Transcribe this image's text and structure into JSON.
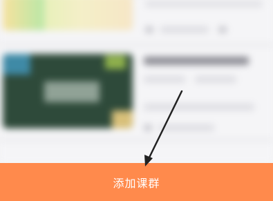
{
  "bottom_bar": {
    "label": "添加课群",
    "color": "#ff8a4c"
  },
  "course_list": {
    "items": [
      {
        "thumbnail": "course-thumbnail-light"
      },
      {
        "thumbnail": "course-thumbnail-chalkboard"
      }
    ]
  },
  "annotation": {
    "arrow_color": "#222222"
  }
}
